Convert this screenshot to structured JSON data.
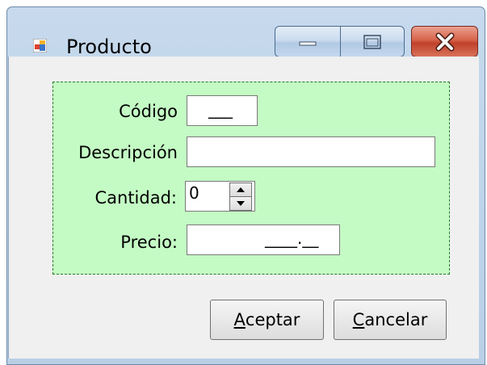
{
  "window": {
    "title": "Producto",
    "icon": "windows-forms-app-icon",
    "caption_buttons": {
      "minimize": "minimize-icon",
      "maximize": "maximize-icon",
      "close": "close-icon"
    }
  },
  "form": {
    "codigo": {
      "label": "Código",
      "mask": "___"
    },
    "descripcion": {
      "label": "Descripción",
      "value": ""
    },
    "cantidad": {
      "label": "Cantidad:",
      "value": "0"
    },
    "precio": {
      "label": "Precio:",
      "mask": "____.__"
    }
  },
  "buttons": {
    "aceptar": {
      "accel": "A",
      "rest": "ceptar"
    },
    "cancelar": {
      "accel": "C",
      "rest": "ancelar"
    }
  },
  "colors": {
    "group_background": "#c4fbc4",
    "close_button": "#c8462e",
    "frame": "#b9cfe7"
  }
}
